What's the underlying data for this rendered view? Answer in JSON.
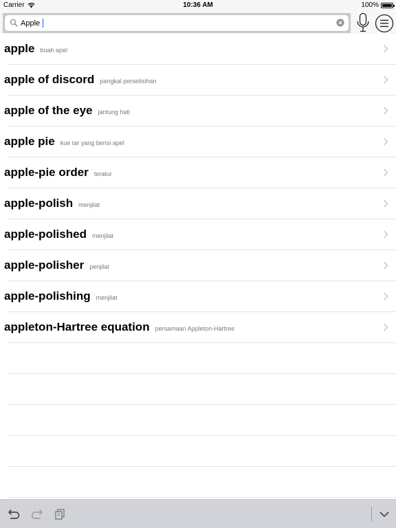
{
  "status": {
    "carrier": "Carrier",
    "time": "10:36 AM",
    "battery": "100%"
  },
  "search": {
    "value": "Apple",
    "icons": [
      "search-icon",
      "clear-icon",
      "microphone-icon",
      "menu-icon"
    ]
  },
  "results": [
    {
      "term": "apple",
      "meaning": "buah apel"
    },
    {
      "term": "apple of discord",
      "meaning": "pangkal perselisihan"
    },
    {
      "term": "apple of the eye",
      "meaning": "jantung hati"
    },
    {
      "term": "apple pie",
      "meaning": "kue tar yang berisi apel"
    },
    {
      "term": "apple-pie order",
      "meaning": "teratur"
    },
    {
      "term": "apple-polish",
      "meaning": "menjilat"
    },
    {
      "term": "apple-polished",
      "meaning": "menjilat"
    },
    {
      "term": "apple-polisher",
      "meaning": "penjilat"
    },
    {
      "term": "apple-polishing",
      "meaning": "menjilat"
    },
    {
      "term": "appleton-Hartree equation",
      "meaning": "persamaan Appleton-Hartree"
    }
  ],
  "toolbar": {
    "icons": [
      "undo-icon",
      "redo-icon",
      "copy-icon",
      "chevron-down-icon"
    ]
  },
  "colors": {
    "accent": "#0a60ff",
    "separator": "#e4e4e4",
    "toolbar": "#d1d3d9"
  }
}
